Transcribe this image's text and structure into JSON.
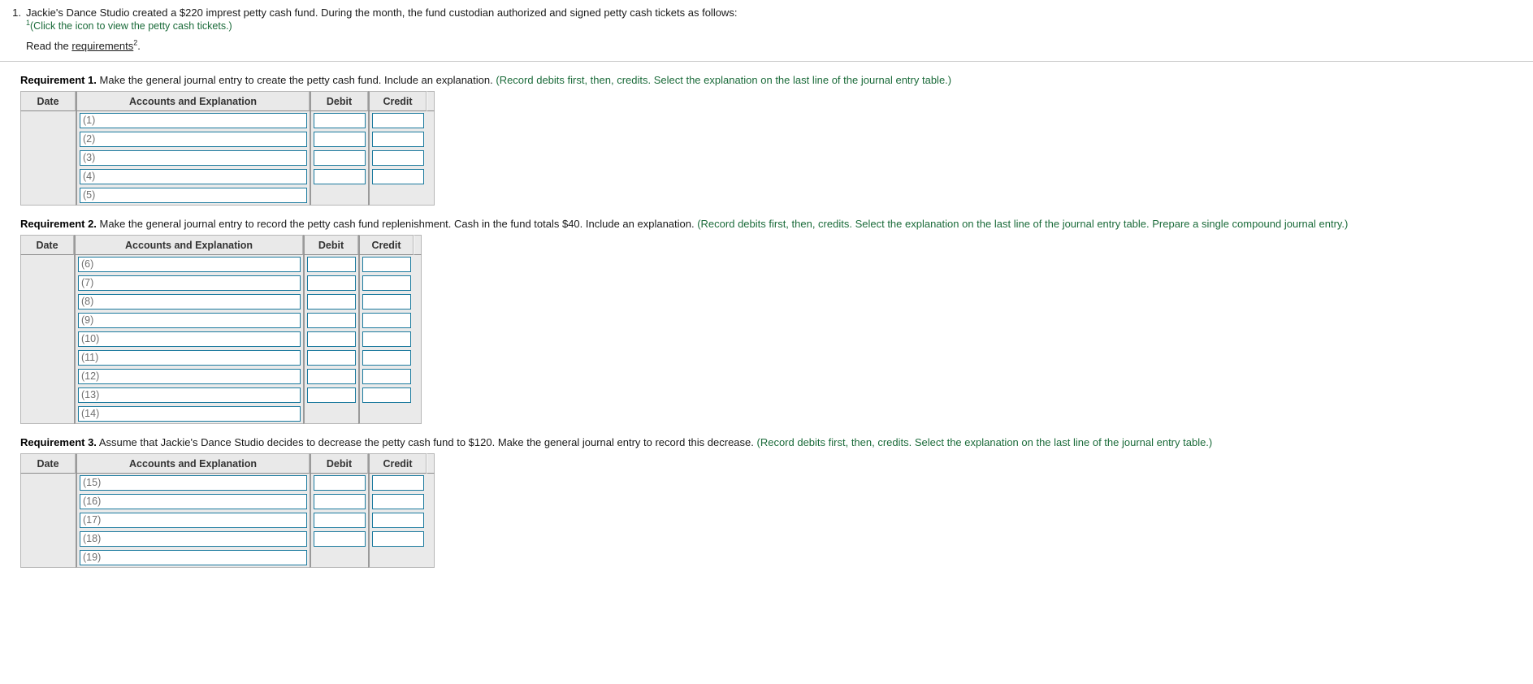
{
  "problem": {
    "number": "1.",
    "statement": "Jackie's Dance Studio created a $220 imprest petty cash fund. During the month, the fund custodian authorized and signed petty cash tickets as follows:",
    "click_icon_footnote": "1",
    "click_icon_text": "(Click the icon to view the petty cash tickets.)",
    "read_prefix": "Read the ",
    "read_link": "requirements",
    "read_footnote": "2",
    "read_suffix": "."
  },
  "colors": {
    "hint_green": "#1b6b3a",
    "input_border": "#1b7a9e",
    "header_bg": "#e9e9e9",
    "table_bg": "#eaeaea"
  },
  "table_headers": {
    "date": "Date",
    "accounts": "Accounts and Explanation",
    "debit": "Debit",
    "credit": "Credit"
  },
  "requirements": [
    {
      "label": "Requirement 1.",
      "text": " Make the general journal entry to create the petty cash fund. Include an explanation. ",
      "hint": "(Record debits first, then, credits. Select the explanation on the last line of the journal entry table.)",
      "table": {
        "col_widths": {
          "date": 68,
          "accounts": 288,
          "debit": 72,
          "credit": 72
        },
        "rows": [
          {
            "date": "",
            "account": "(1)",
            "debit": "",
            "credit": "",
            "has_amounts": true
          },
          {
            "date": "",
            "account": "(2)",
            "debit": "",
            "credit": "",
            "has_amounts": true
          },
          {
            "date": "",
            "account": "(3)",
            "debit": "",
            "credit": "",
            "has_amounts": true
          },
          {
            "date": "",
            "account": "(4)",
            "debit": "",
            "credit": "",
            "has_amounts": true
          },
          {
            "date": "",
            "account": "(5)",
            "debit": "",
            "credit": "",
            "has_amounts": false
          }
        ]
      }
    },
    {
      "label": "Requirement 2.",
      "text": " Make the general journal entry to record the petty cash fund replenishment. Cash in the fund totals $40. Include an explanation. ",
      "hint": "(Record debits first, then, credits. Select the explanation on the last line of the journal entry table. Prepare a single compound journal entry.)",
      "table": {
        "col_widths": {
          "date": 66,
          "accounts": 282,
          "debit": 68,
          "credit": 68
        },
        "rows": [
          {
            "date": "",
            "account": "(6)",
            "debit": "",
            "credit": "",
            "has_amounts": true
          },
          {
            "date": "",
            "account": "(7)",
            "debit": "",
            "credit": "",
            "has_amounts": true
          },
          {
            "date": "",
            "account": "(8)",
            "debit": "",
            "credit": "",
            "has_amounts": true
          },
          {
            "date": "",
            "account": "(9)",
            "debit": "",
            "credit": "",
            "has_amounts": true
          },
          {
            "date": "",
            "account": "(10)",
            "debit": "",
            "credit": "",
            "has_amounts": true
          },
          {
            "date": "",
            "account": "(11)",
            "debit": "",
            "credit": "",
            "has_amounts": true
          },
          {
            "date": "",
            "account": "(12)",
            "debit": "",
            "credit": "",
            "has_amounts": true
          },
          {
            "date": "",
            "account": "(13)",
            "debit": "",
            "credit": "",
            "has_amounts": true
          },
          {
            "date": "",
            "account": "(14)",
            "debit": "",
            "credit": "",
            "has_amounts": false
          }
        ]
      }
    },
    {
      "label": "Requirement 3.",
      "text": " Assume that Jackie's Dance Studio decides to decrease the petty cash fund to $120. Make the general journal entry to record this decrease. ",
      "hint": "(Record debits first, then, credits. Select the explanation on the last line of the journal entry table.)",
      "table": {
        "col_widths": {
          "date": 68,
          "accounts": 288,
          "debit": 72,
          "credit": 72
        },
        "rows": [
          {
            "date": "",
            "account": "(15)",
            "debit": "",
            "credit": "",
            "has_amounts": true
          },
          {
            "date": "",
            "account": "(16)",
            "debit": "",
            "credit": "",
            "has_amounts": true
          },
          {
            "date": "",
            "account": "(17)",
            "debit": "",
            "credit": "",
            "has_amounts": true
          },
          {
            "date": "",
            "account": "(18)",
            "debit": "",
            "credit": "",
            "has_amounts": true
          },
          {
            "date": "",
            "account": "(19)",
            "debit": "",
            "credit": "",
            "has_amounts": false
          }
        ]
      }
    }
  ]
}
